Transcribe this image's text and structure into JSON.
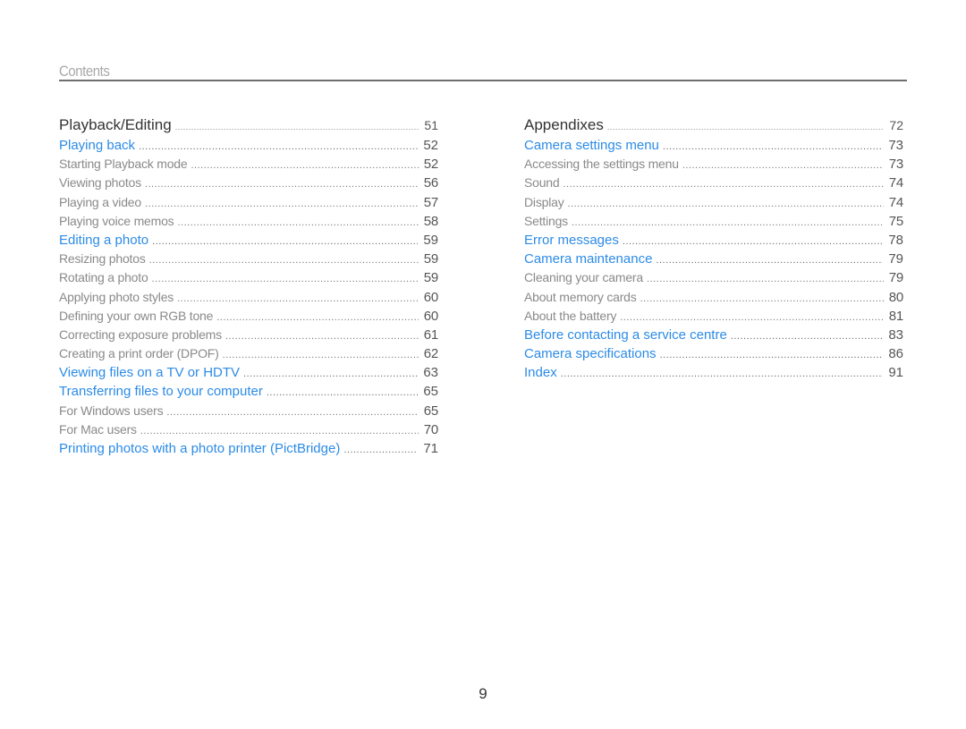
{
  "header": {
    "title": "Contents"
  },
  "columns": [
    {
      "entries": [
        {
          "level": "section",
          "label": "Playback/Editing",
          "page": "51"
        },
        {
          "level": "topic",
          "label": "Playing back",
          "page": "52"
        },
        {
          "level": "sub",
          "label": "Starting Playback mode",
          "page": "52"
        },
        {
          "level": "sub",
          "label": "Viewing photos",
          "page": "56"
        },
        {
          "level": "sub",
          "label": "Playing a video",
          "page": "57"
        },
        {
          "level": "sub",
          "label": "Playing voice memos",
          "page": "58"
        },
        {
          "level": "topic",
          "label": "Editing a photo",
          "page": "59"
        },
        {
          "level": "sub",
          "label": "Resizing photos",
          "page": "59"
        },
        {
          "level": "sub",
          "label": "Rotating a photo",
          "page": "59"
        },
        {
          "level": "sub",
          "label": "Applying photo styles",
          "page": "60"
        },
        {
          "level": "sub",
          "label": "Defining your own RGB tone",
          "page": "60"
        },
        {
          "level": "sub",
          "label": "Correcting exposure problems",
          "page": "61"
        },
        {
          "level": "sub",
          "label": "Creating a print order (DPOF)",
          "page": "62"
        },
        {
          "level": "topic",
          "label": "Viewing files on a TV or HDTV",
          "page": "63"
        },
        {
          "level": "topic",
          "label": "Transferring files to your computer",
          "page": "65"
        },
        {
          "level": "sub",
          "label": "For Windows users",
          "page": "65"
        },
        {
          "level": "sub",
          "label": "For Mac users",
          "page": "70"
        },
        {
          "level": "topic",
          "label": "Printing photos with a photo printer (PictBridge)",
          "page": "71"
        }
      ]
    },
    {
      "entries": [
        {
          "level": "section",
          "label": "Appendixes",
          "page": "72"
        },
        {
          "level": "topic",
          "label": "Camera settings menu",
          "page": "73"
        },
        {
          "level": "sub",
          "label": "Accessing the settings menu",
          "page": "73"
        },
        {
          "level": "sub",
          "label": "Sound",
          "page": "74"
        },
        {
          "level": "sub",
          "label": "Display",
          "page": "74"
        },
        {
          "level": "sub",
          "label": "Settings",
          "page": "75"
        },
        {
          "level": "topic",
          "label": "Error messages",
          "page": "78"
        },
        {
          "level": "topic",
          "label": "Camera maintenance",
          "page": "79"
        },
        {
          "level": "sub",
          "label": "Cleaning your camera",
          "page": "79"
        },
        {
          "level": "sub",
          "label": "About memory cards",
          "page": "80"
        },
        {
          "level": "sub",
          "label": "About the battery",
          "page": "81"
        },
        {
          "level": "topic",
          "label": "Before contacting a service centre",
          "page": "83"
        },
        {
          "level": "topic",
          "label": "Camera specifications",
          "page": "86"
        },
        {
          "level": "topic",
          "label": "Index",
          "page": "91"
        }
      ]
    }
  ],
  "colors": {
    "topic": "#2c8be6",
    "section": "#333333",
    "sub": "#8a8a8a"
  },
  "footer": {
    "page_number": "9"
  }
}
